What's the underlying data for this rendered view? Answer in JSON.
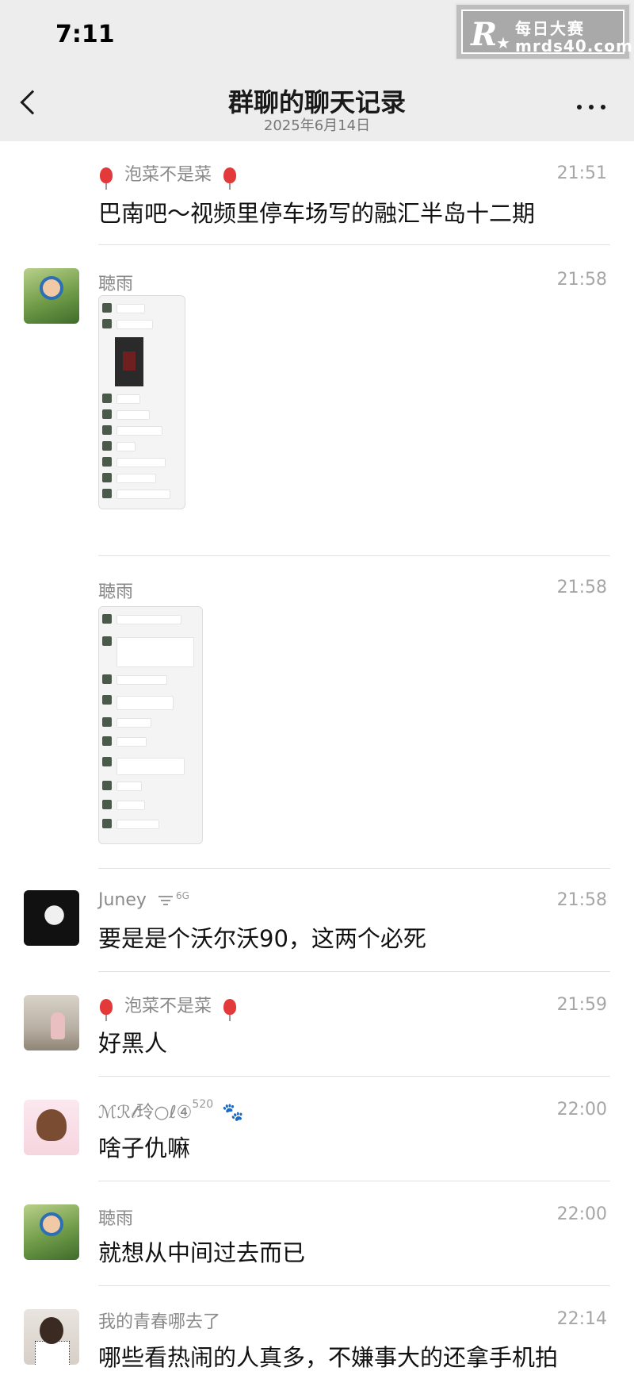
{
  "status_bar": {
    "time": "7:11"
  },
  "watermark": {
    "logo": "R",
    "star": "★",
    "brand": "每日大赛",
    "url": "mrds40.com"
  },
  "nav": {
    "title": "群聊的聊天记录",
    "subtitle": "2025年6月14日"
  },
  "messages": [
    {
      "sender": "泡菜不是菜",
      "time": "21:51",
      "text": "巴南吧～视频里停车场写的融汇半岛十二期"
    },
    {
      "sender": "聴雨",
      "time": "21:58",
      "image": "chat-screenshot"
    },
    {
      "sender": "聴雨",
      "time": "21:58",
      "image": "chat-screenshot"
    },
    {
      "sender": "Juney",
      "sender_tag": "6G",
      "time": "21:58",
      "text": "要是是个沃尔沃90，这两个必死"
    },
    {
      "sender": "泡菜不是菜",
      "time": "21:59",
      "text": "好黑人"
    },
    {
      "sender": "ℳℛ𝓁玲○ℓ④",
      "sender_tag": "520",
      "time": "22:00",
      "text": "啥子仇嘛"
    },
    {
      "sender": "聴雨",
      "time": "22:00",
      "text": "就想从中间过去而已"
    },
    {
      "sender": "我的青春哪去了",
      "time": "22:14",
      "text": "哪些看热闹的人真多，不嫌事大的还拿手机拍"
    }
  ]
}
